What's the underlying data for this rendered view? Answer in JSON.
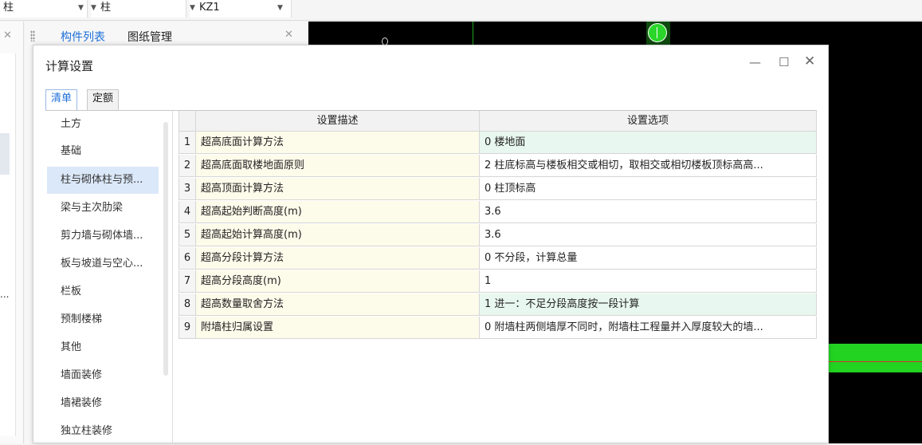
{
  "toolbar": {
    "combo1": "柱",
    "combo2": "柱",
    "combo3": "KZ1"
  },
  "left_panel": {
    "tabs": [
      "构件列表",
      "图纸管理"
    ],
    "ellipsis": "..."
  },
  "dialog": {
    "title": "计算设置",
    "tabs": [
      "清单",
      "定额"
    ],
    "active_tab": "清单",
    "categories": [
      "土方",
      "基础",
      "柱与砌体柱与预...",
      "梁与主次肋梁",
      "剪力墙与砌体墙...",
      "板与坡道与空心...",
      "栏板",
      "预制楼梯",
      "其他",
      "墙面装修",
      "墙裙装修",
      "独立柱装修"
    ],
    "selected_category": "柱与砌体柱与预...",
    "table": {
      "headers": [
        "设置描述",
        "设置选项"
      ],
      "rows": [
        {
          "num": "1",
          "desc": "超高底面计算方法",
          "option": "0 楼地面",
          "highlight": true
        },
        {
          "num": "2",
          "desc": "超高底面取楼地面原则",
          "option": "2 柱底标高与楼板相交或相切，取相交或相切楼板顶标高高...",
          "highlight": false
        },
        {
          "num": "3",
          "desc": "超高顶面计算方法",
          "option": "0 柱顶标高",
          "highlight": false
        },
        {
          "num": "4",
          "desc": "超高起始判断高度(m)",
          "option": "3.6",
          "highlight": false
        },
        {
          "num": "5",
          "desc": "超高起始计算高度(m)",
          "option": "3.6",
          "highlight": false
        },
        {
          "num": "6",
          "desc": "超高分段计算方法",
          "option": "0 不分段，计算总量",
          "highlight": false
        },
        {
          "num": "7",
          "desc": "超高分段高度(m)",
          "option": "1",
          "highlight": false
        },
        {
          "num": "8",
          "desc": "超高数量取舍方法",
          "option": "1 进一：不足分段高度按一段计算",
          "highlight": true
        },
        {
          "num": "9",
          "desc": "附墙柱归属设置",
          "option": "0 附墙柱两侧墙厚不同时，附墙柱工程量并入厚度较大的墙...",
          "highlight": false
        }
      ]
    }
  },
  "colors": {
    "accent": "#1e6fd9",
    "canvas_bg": "#000000",
    "canvas_green": "#22d322",
    "desc_bg": "#fdfbea",
    "highlight_bg": "#e8f7f0"
  }
}
